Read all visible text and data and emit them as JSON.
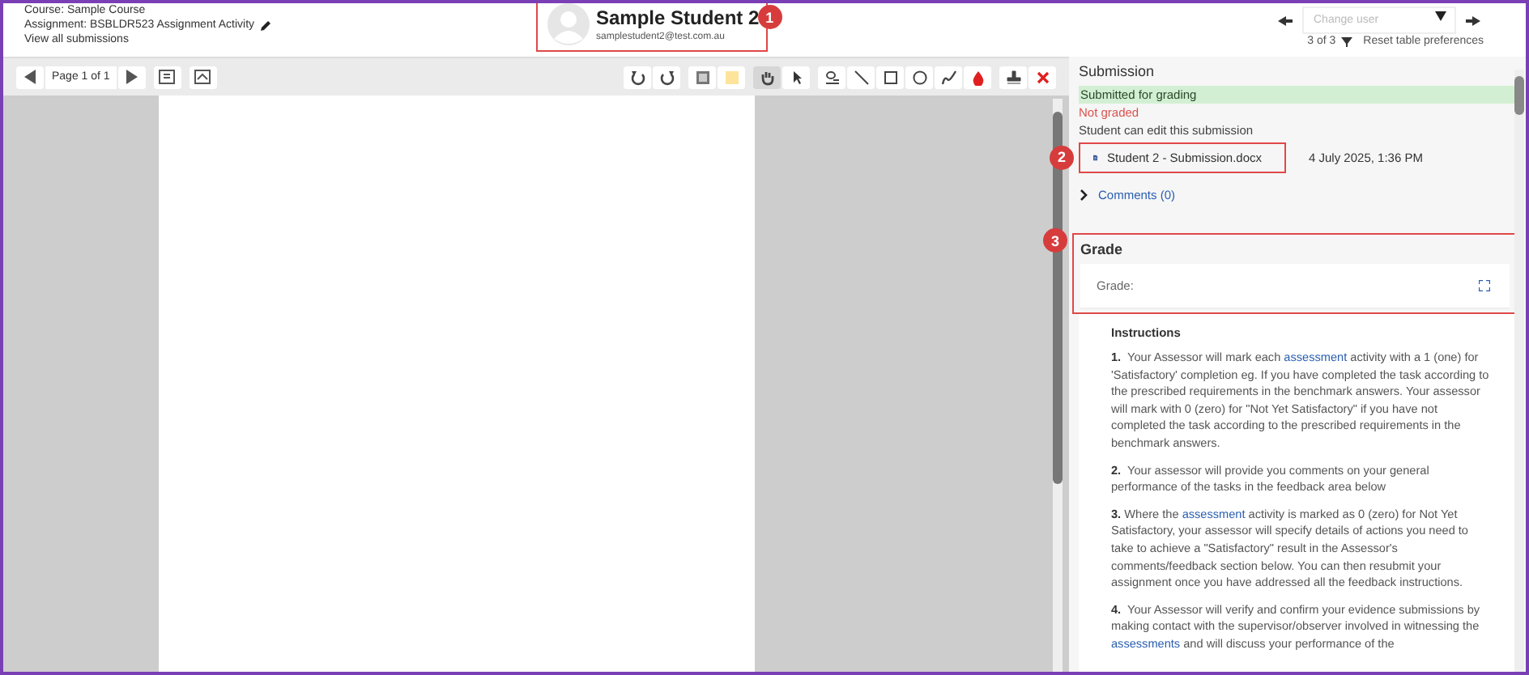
{
  "header": {
    "course": "Course: Sample Course",
    "assignment": "Assignment: BSBLDR523 Assignment Activity",
    "view_all": "View all submissions",
    "student": {
      "name": "Sample Student 2",
      "email": "samplestudent2@test.com.au",
      "callout": "1"
    },
    "user_select": {
      "placeholder": "Change user"
    },
    "count": "3 of 3",
    "reset": "Reset table preferences"
  },
  "toolbar": {
    "page": "Page 1 of 1",
    "tools": [
      {
        "selected": false
      },
      {
        "selected": false
      },
      {
        "selected": false
      },
      {
        "selected": false
      },
      {
        "selected": true
      },
      {
        "selected": false
      },
      {
        "selected": false
      },
      {
        "selected": false
      },
      {
        "selected": false
      },
      {
        "selected": false
      },
      {
        "selected": false
      },
      {
        "selected": false
      },
      {
        "selected": false
      },
      {
        "selected": false
      }
    ]
  },
  "submission": {
    "title": "Submission",
    "status": "Submitted for grading",
    "grading_status": "Not graded",
    "edit_note": "Student can edit this submission",
    "file": {
      "name": "Student 2 - Submission.docx",
      "callout": "2"
    },
    "date": "4 July 2025, 1:36 PM",
    "comments": {
      "label": "Comments (0)",
      "expanded": false
    }
  },
  "grade": {
    "title": "Grade",
    "callout": "3",
    "field_label": "Grade:",
    "instructions": {
      "title": "Instructions",
      "paragraphs": [
        [
          {
            "kind": "text",
            "text": "**1.**  Your Assessor will mark each "
          },
          {
            "kind": "link",
            "text": "assessment"
          },
          {
            "kind": "text",
            "text": " activity with a 1 (one) for  'Satisfactory' completion eg. If you have completed the task according to the prescribed requirements in the benchmark answers. Your assessor will mark with 0 (zero) for \"Not Yet Satisfactory\" if you have not completed the task according to the prescribed requirements in the benchmark answers."
          }
        ],
        [
          {
            "kind": "text",
            "text": "**2.**  Your assessor will provide you comments on your general performance of the tasks in the feedback area below"
          }
        ],
        [
          {
            "kind": "text",
            "text": "**3.** Where the "
          },
          {
            "kind": "link",
            "text": "assessment"
          },
          {
            "kind": "text",
            "text": " activity is marked as 0 (zero) for Not Yet Satisfactory, your assessor will specify details of actions you need to take to achieve a \"Satisfactory\" result in the Assessor's comments/feedback section below. You can then resubmit your assignment once you have addressed all the feedback instructions."
          }
        ],
        [
          {
            "kind": "text",
            "text": "**4.**  Your Assessor will verify and confirm your evidence submissions by making contact with the supervisor/observer involved in witnessing the "
          },
          {
            "kind": "link",
            "text": "assessments"
          },
          {
            "kind": "text",
            "text": " and will discuss your performance of the"
          }
        ]
      ]
    }
  }
}
